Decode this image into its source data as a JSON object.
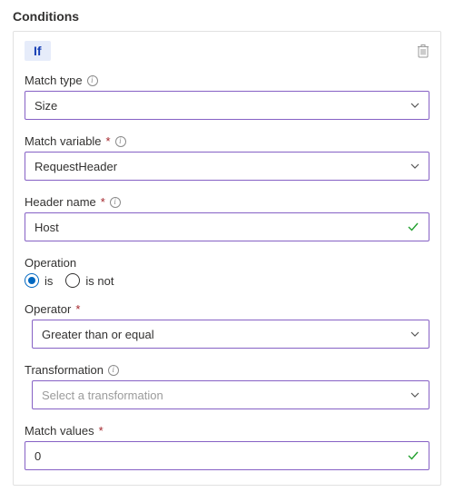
{
  "section_title": "Conditions",
  "badge": "If",
  "match_type": {
    "label": "Match type",
    "value": "Size"
  },
  "match_variable": {
    "label": "Match variable",
    "value": "RequestHeader"
  },
  "header_name": {
    "label": "Header name",
    "value": "Host"
  },
  "operation": {
    "label": "Operation",
    "options": {
      "is": "is",
      "is_not": "is not"
    },
    "selected": "is"
  },
  "operator": {
    "label": "Operator",
    "value": "Greater than or equal"
  },
  "transformation": {
    "label": "Transformation",
    "placeholder": "Select a transformation"
  },
  "match_values": {
    "label": "Match values",
    "value": "0"
  }
}
